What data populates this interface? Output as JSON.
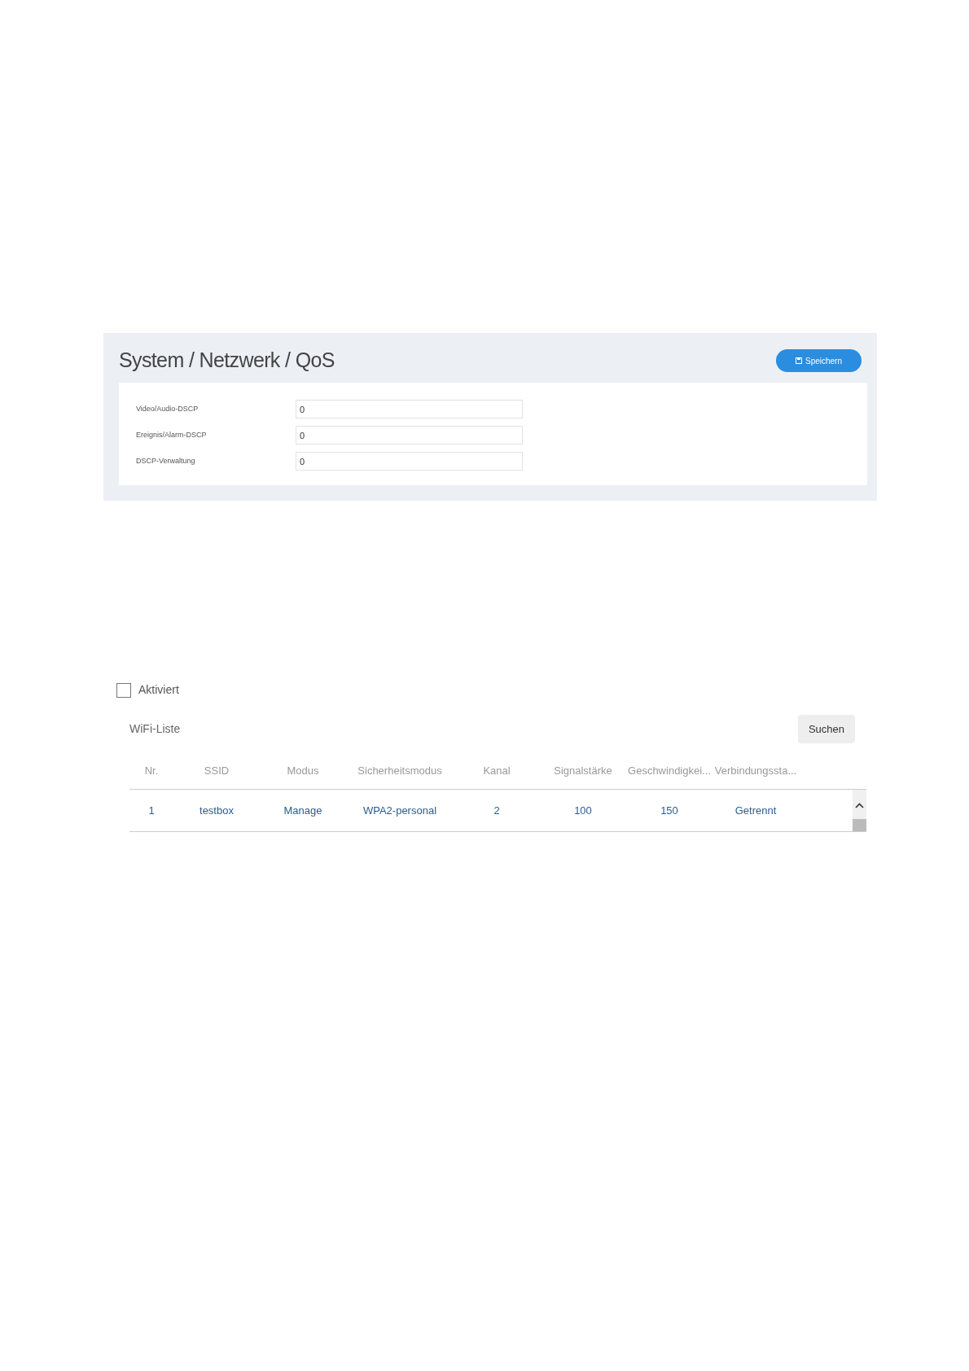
{
  "qos_panel": {
    "title": "System / Netzwerk / QoS",
    "save_button": "Speichern",
    "fields": [
      {
        "label": "Video/Audio-DSCP",
        "value": "0"
      },
      {
        "label": "Ereignis/Alarm-DSCP",
        "value": "0"
      },
      {
        "label": "DSCP-Verwaltung",
        "value": "0"
      }
    ]
  },
  "wifi": {
    "enabled": {
      "label": "Aktiviert",
      "checked": false
    },
    "list_title": "WiFi-Liste",
    "search_button": "Suchen",
    "table": {
      "columns": [
        "Nr.",
        "SSID",
        "Modus",
        "Sicherheitsmodus",
        "Kanal",
        "Signalstärke",
        "Geschwindigkei...",
        "Verbindungssta..."
      ],
      "rows": [
        [
          "1",
          "testbox",
          "Manage",
          "WPA2-personal",
          "2",
          "100",
          "150",
          "Getrennt"
        ]
      ]
    }
  }
}
